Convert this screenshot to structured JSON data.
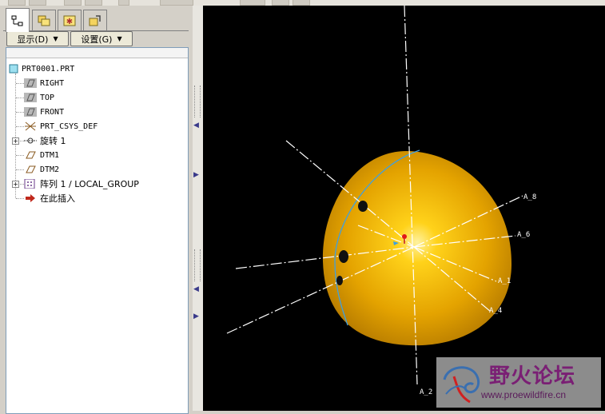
{
  "toolbar": {},
  "panel": {
    "tabs": [
      {
        "icon": "model-tree-icon",
        "active": true
      },
      {
        "icon": "folder-browser-icon",
        "active": false
      },
      {
        "icon": "favorites-icon",
        "active": false
      },
      {
        "icon": "connections-icon",
        "active": false
      }
    ],
    "show_menu": "显示(D)",
    "settings_menu": "设置(G)"
  },
  "tree": {
    "root": "PRT0001.PRT",
    "items": [
      {
        "label": "RIGHT",
        "icon": "datum-plane-icon"
      },
      {
        "label": "TOP",
        "icon": "datum-plane-icon"
      },
      {
        "label": "FRONT",
        "icon": "datum-plane-icon"
      },
      {
        "label": "PRT_CSYS_DEF",
        "icon": "coordinate-system-icon"
      },
      {
        "label": "旋转 1",
        "icon": "revolve-feature-icon",
        "expandable": true
      },
      {
        "label": "DTM1",
        "icon": "datum-plane-icon"
      },
      {
        "label": "DTM2",
        "icon": "datum-plane-icon"
      },
      {
        "label": "阵列 1 / LOCAL_GROUP",
        "icon": "pattern-icon",
        "expandable": true
      },
      {
        "label": "在此插入",
        "icon": "insert-here-arrow-icon"
      }
    ]
  },
  "viewport": {
    "axis_labels": [
      "A_8",
      "A_6",
      "A_1",
      "A_4",
      "A_2"
    ],
    "colors": {
      "background": "#000000",
      "part": "#f0b000",
      "axis": "#ffffff",
      "sketch_curve": "#3fa0e0"
    }
  },
  "watermark": {
    "title": "野火论坛",
    "url": "www.proewildfire.cn"
  }
}
